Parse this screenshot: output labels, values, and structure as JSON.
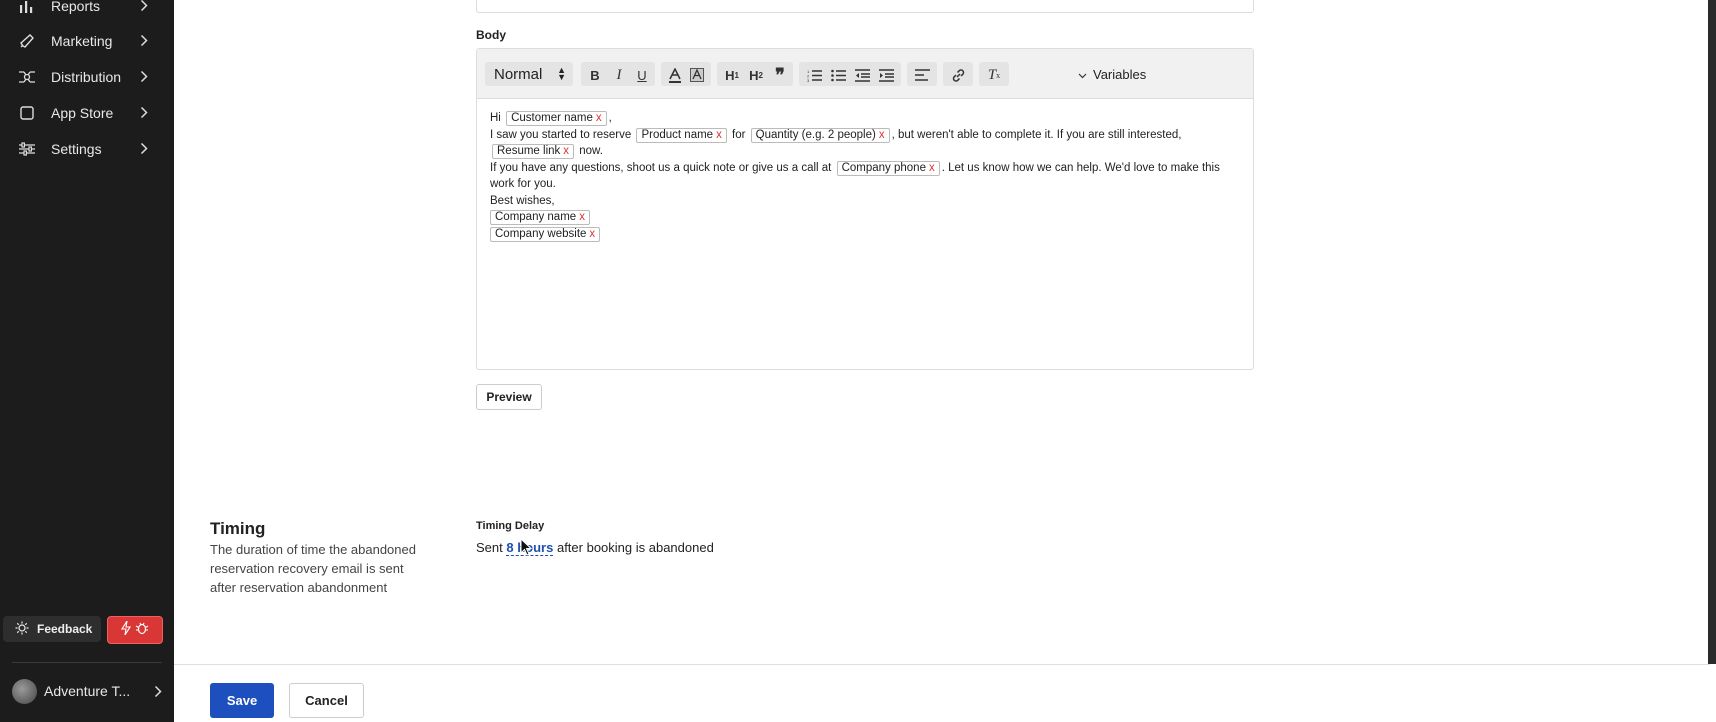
{
  "sidebar": {
    "items": [
      {
        "label": "Reports",
        "icon": "bar-chart-icon"
      },
      {
        "label": "Marketing",
        "icon": "megaphone-icon"
      },
      {
        "label": "Distribution",
        "icon": "distribution-icon"
      },
      {
        "label": "App Store",
        "icon": "app-store-icon"
      },
      {
        "label": "Settings",
        "icon": "sliders-icon"
      }
    ],
    "feedback_label": "Feedback",
    "account_name": "Adventure T..."
  },
  "editor": {
    "body_label": "Body",
    "format_value": "Normal",
    "variables_label": "Variables",
    "content": {
      "line1_pre": "Hi",
      "chip_customer_name": "Customer name",
      "line1_post": ",",
      "line2_a": "I saw you started to reserve",
      "chip_product_name": "Product name",
      "line2_b": "for",
      "chip_quantity": "Quantity (e.g. 2 people)",
      "line2_c": ", but weren't able to complete it. If you are still interested,",
      "chip_resume_link": "Resume link",
      "line2_d": "now.",
      "line3_a": "If you have any questions, shoot us a quick note or give us a call at",
      "chip_company_phone": "Company phone",
      "line3_b": ". Let us know how we can help. We'd love to make this work for you.",
      "line4": "Best wishes,",
      "chip_company_name": "Company name",
      "chip_company_website": "Company website",
      "chip_remove": "x"
    }
  },
  "preview_label": "Preview",
  "timing": {
    "title": "Timing",
    "description": "The duration of time the abandoned reservation recovery email is sent after reservation abandonment",
    "delay_label": "Timing Delay",
    "sentence_pre": "Sent",
    "delay_value": "8 hours",
    "sentence_post": "after booking is abandoned"
  },
  "footer": {
    "save_label": "Save",
    "cancel_label": "Cancel"
  },
  "colors": {
    "sidebar_bg": "#1c1c1c",
    "primary": "#1e4fbf",
    "bug_button": "#d93636",
    "chip_remove": "#dd3333"
  }
}
